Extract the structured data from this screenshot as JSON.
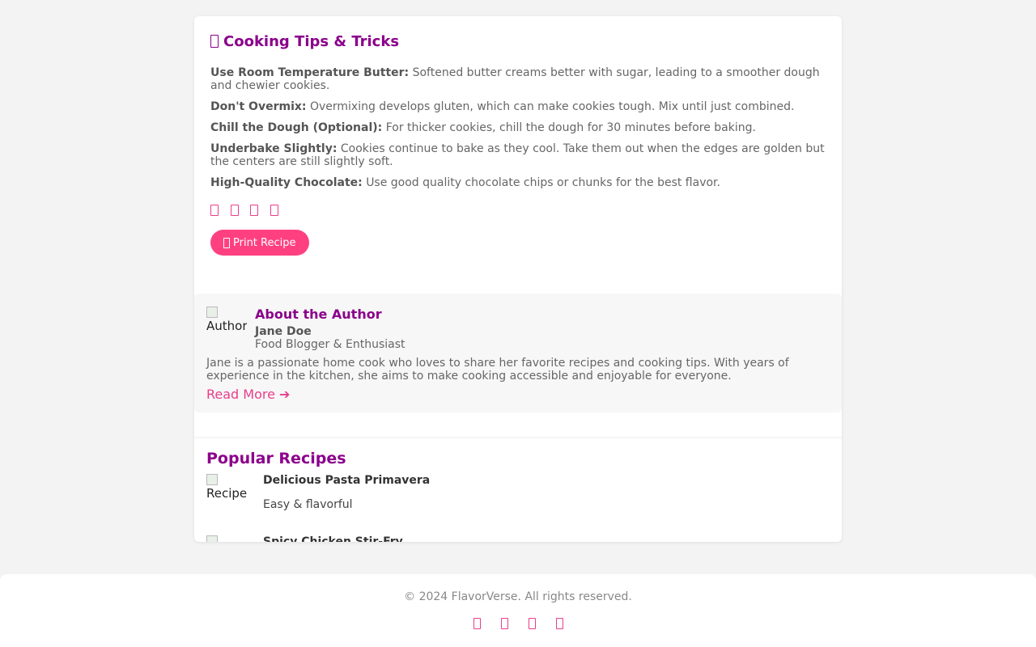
{
  "tips": {
    "title": "Cooking Tips & Tricks",
    "title_icon": "missing-glyph-icon",
    "items": [
      {
        "label": "Use Room Temperature Butter:",
        "text": "Softened butter creams better with sugar, leading to a smoother dough and chewier cookies."
      },
      {
        "label": "Don't Overmix:",
        "text": "Overmixing develops gluten, which can make cookies tough. Mix until just combined."
      },
      {
        "label": "Chill the Dough (Optional):",
        "text": "For thicker cookies, chill the dough for 30 minutes before baking."
      },
      {
        "label": "Underbake Slightly:",
        "text": "Cookies continue to bake as they cool. Take them out when the edges are golden but the centers are still slightly soft."
      },
      {
        "label": "High-Quality Chocolate:",
        "text": "Use good quality chocolate chips or chunks for the best flavor."
      }
    ],
    "share_icons": [
      "share-icon-1",
      "share-icon-2",
      "share-icon-3",
      "share-icon-4"
    ],
    "print_label": "Print Recipe"
  },
  "author": {
    "image_alt": "Author",
    "heading": "About the Author",
    "name": "Jane Doe",
    "role": "Food Blogger & Enthusiast",
    "bio": "Jane is a passionate home cook who loves to share her favorite recipes and cooking tips. With years of experience in the kitchen, she aims to make cooking accessible and enjoyable for everyone.",
    "read_more": "Read More ➔"
  },
  "popular": {
    "title": "Popular Recipes",
    "recipes": [
      {
        "image_alt": "Recipe",
        "name": "Delicious Pasta Primavera",
        "desc": "Easy & flavorful"
      },
      {
        "image_alt": "Recipe",
        "name": "Spicy Chicken Stir-Fry",
        "desc": ""
      }
    ]
  },
  "footer": {
    "copyright": "© 2024 FlavorVerse. All rights reserved.",
    "social_icons": [
      "social-icon-1",
      "social-icon-2",
      "social-icon-3",
      "social-icon-4"
    ]
  },
  "colors": {
    "accent": "#8b008b",
    "pink": "#ff4080",
    "link": "#e83e8c",
    "background": "#f3f3f3"
  }
}
